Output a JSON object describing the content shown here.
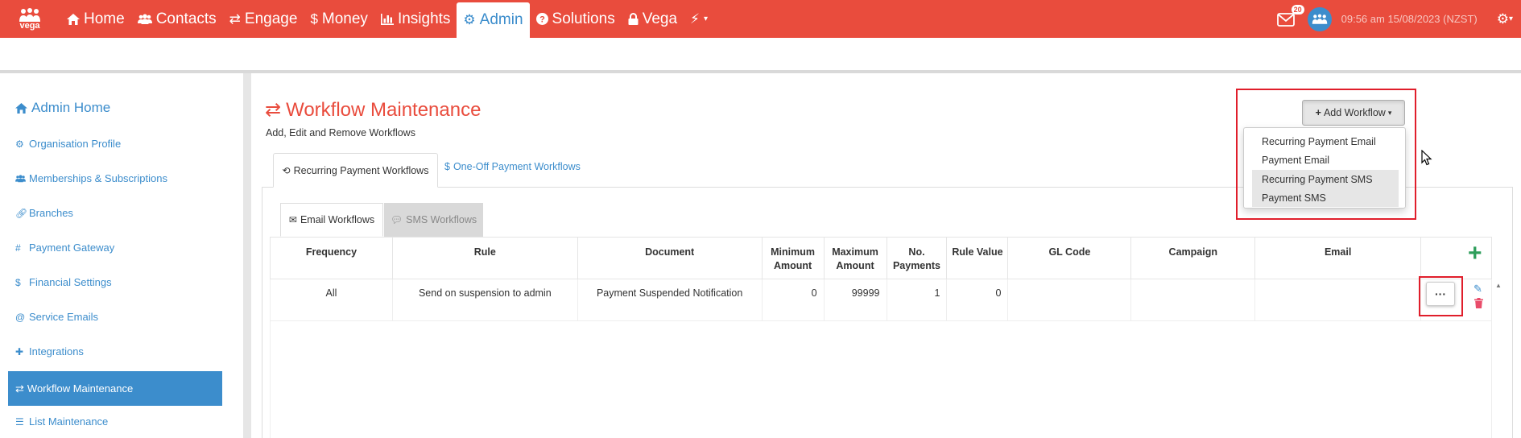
{
  "brand": {
    "logo_text": "vega"
  },
  "nav": {
    "items": [
      {
        "label": "Home",
        "icon": "home-icon"
      },
      {
        "label": "Contacts",
        "icon": "users-icon"
      },
      {
        "label": "Engage",
        "icon": "exchange-icon"
      },
      {
        "label": "Money",
        "icon": "dollar-icon"
      },
      {
        "label": "Insights",
        "icon": "bar-chart-icon"
      },
      {
        "label": "Admin",
        "icon": "cogs-icon",
        "active": true
      },
      {
        "label": "Solutions",
        "icon": "question-circle-icon"
      },
      {
        "label": "Vega",
        "icon": "lock-icon"
      },
      {
        "label": "",
        "icon": "bolt-icon"
      }
    ],
    "mail_badge": "20",
    "datetime": "09:56 am 15/08/2023 (NZST)"
  },
  "sidebar": {
    "home": "Admin Home",
    "items": [
      {
        "label": "Organisation Profile",
        "icon": "gear-icon"
      },
      {
        "label": "Memberships & Subscriptions",
        "icon": "users-icon"
      },
      {
        "label": "Branches",
        "icon": "link-icon"
      },
      {
        "label": "Payment Gateway",
        "icon": "hash-icon"
      },
      {
        "label": "Financial Settings",
        "icon": "dollar-icon"
      },
      {
        "label": "Service Emails",
        "icon": "at-icon"
      },
      {
        "label": "Integrations",
        "icon": "puzzle-icon"
      },
      {
        "label": "Workflow Maintenance",
        "icon": "exchange-icon",
        "active": true
      },
      {
        "label": "List Maintenance",
        "icon": "list-icon"
      }
    ]
  },
  "main": {
    "title": "Workflow Maintenance",
    "subtitle": "Add, Edit and Remove Workflows",
    "tabs": [
      {
        "label": "Recurring Payment Workflows",
        "active": true
      },
      {
        "label": "One-Off Payment Workflows"
      }
    ],
    "subtabs": [
      {
        "label": "Email Workflows",
        "active": true
      },
      {
        "label": "SMS Workflows"
      }
    ],
    "add_button": "Add Workflow",
    "add_menu": [
      "Recurring Payment Email",
      "Payment Email",
      "Recurring Payment SMS",
      "Payment SMS"
    ],
    "table": {
      "headers": [
        "Frequency",
        "Rule",
        "Document",
        "Minimum Amount",
        "Maximum Amount",
        "No. Payments",
        "Rule Value",
        "GL Code",
        "Campaign",
        "Email",
        ""
      ],
      "rows": [
        [
          "All",
          "Send on suspension to admin",
          "Payment Suspended Notification",
          "0",
          "99999",
          "1",
          "0",
          "",
          "",
          "",
          ""
        ]
      ],
      "more_label": "···"
    }
  },
  "colors": {
    "brand_red": "#e94c3d",
    "link_blue": "#3c8dcc",
    "highlight_red": "#e01e2b",
    "add_green": "#2e9e5b"
  }
}
